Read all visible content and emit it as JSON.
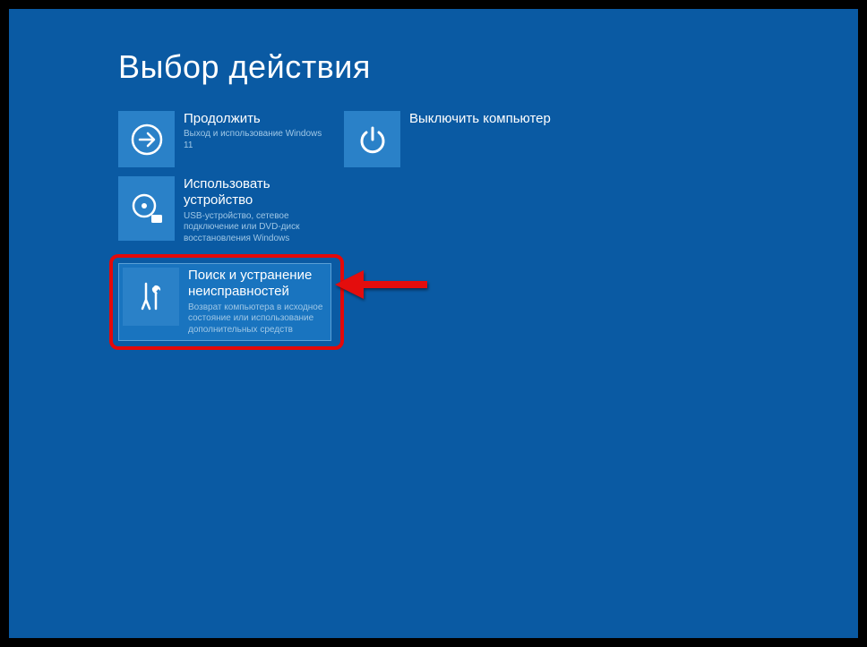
{
  "page": {
    "title": "Выбор действия"
  },
  "tiles": {
    "continue": {
      "title": "Продолжить",
      "desc": "Выход и использование Windows 11"
    },
    "shutdown": {
      "title": "Выключить компьютер"
    },
    "use_device": {
      "title": "Использовать устройство",
      "desc": "USB-устройство, сетевое подключение или DVD-диск восстановления Windows"
    },
    "troubleshoot": {
      "title": "Поиск и устранение неисправностей",
      "desc": "Возврат компьютера в исходное состояние или использование дополнительных средств"
    }
  }
}
